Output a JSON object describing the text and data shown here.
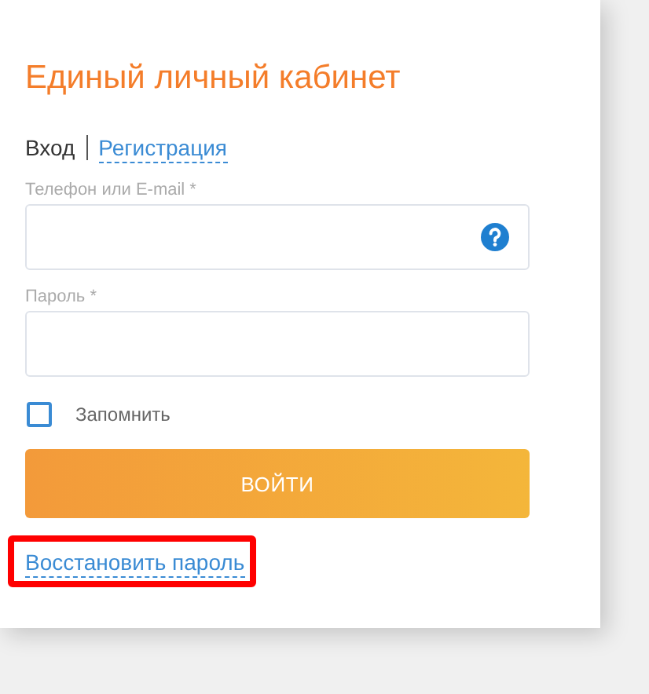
{
  "title": "Единый личный кабинет",
  "tabs": [
    {
      "label": "Вход",
      "selected": true
    },
    {
      "label": "Регистрация",
      "selected": false
    }
  ],
  "fields": [
    {
      "label": "Телефон или E-mail *",
      "help": true
    },
    {
      "label": "Пароль *",
      "help": false
    }
  ],
  "remember": {
    "label": "Запомнить",
    "checked": false
  },
  "submit": "ВОЙТИ",
  "recover_link": {
    "label": "Восстановить пароль",
    "highlighted": true
  }
}
